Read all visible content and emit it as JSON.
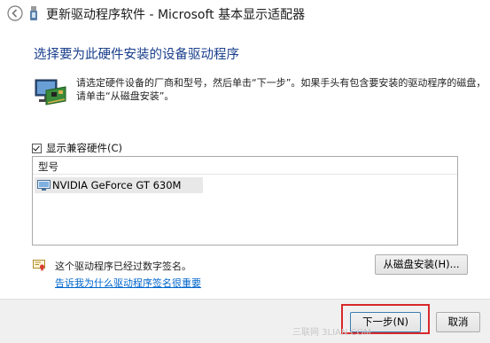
{
  "window": {
    "title": "更新驱动程序软件 - Microsoft 基本显示适配器",
    "back_icon": "back-arrow-icon",
    "title_icon": "usb-device-icon"
  },
  "main": {
    "heading": "选择要为此硬件安装的设备驱动程序",
    "hardware_icon": "hardware-board-icon",
    "instruction_line1": "请选定硬件设备的厂商和型号，然后单击“下一步”。如果手头有包含要安装的驱动程序的磁盘，",
    "instruction_line2": "请单击“从磁盘安装”。",
    "compat_checkbox": {
      "label": "显示兼容硬件(C)",
      "checked": true
    },
    "model_list": {
      "header": "型号",
      "items": [
        {
          "label": "NVIDIA GeForce GT 630M",
          "icon": "display-adapter-icon",
          "selected": true
        }
      ]
    },
    "signed_icon": "certificate-icon",
    "signed_text": "这个驱动程序已经过数字签名。",
    "sign_link": "告诉我为什么驱动程序签名很重要",
    "disk_button": "从磁盘安装(H)..."
  },
  "footer": {
    "next_button": "下一步(N)",
    "cancel_button": "取消",
    "highlight_color": "#d8282a"
  },
  "watermark": "三联网 3LIAN.COM"
}
